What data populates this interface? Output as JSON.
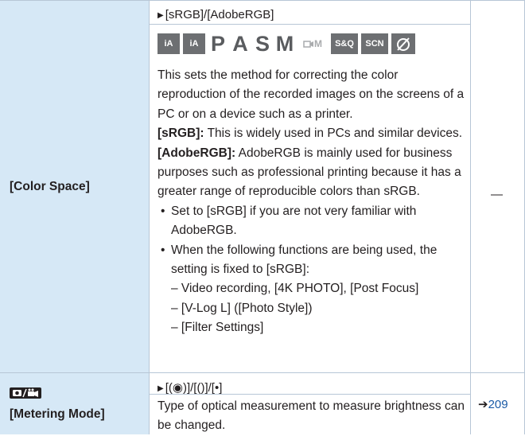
{
  "rows": [
    {
      "name": "[Color Space]",
      "options": "[sRGB]/[AdobeRGB]",
      "modes": {
        "icons": [
          "iA",
          "iA+",
          "P",
          "A",
          "S",
          "M",
          "movie-M",
          "S&Q",
          "SCN",
          "filter"
        ],
        "labels": [
          "iA",
          "iA",
          "P",
          "A",
          "S",
          "M",
          "M",
          "S&Q",
          "SCN"
        ]
      },
      "description": "This sets the method for correcting the color reproduction of the recorded images on the screens of a PC or on a device such as a printer.",
      "srgb_label": "[sRGB]:",
      "srgb_text": "This is widely used in PCs and similar devices.",
      "adobe_label": "[AdobeRGB]:",
      "adobe_text": "AdobeRGB is mainly used for business purposes such as professional printing because it has a greater range of reproducible colors than sRGB.",
      "bullets": [
        "Set to [sRGB] if you are not very familiar with AdobeRGB.",
        "When the following functions are being used, the setting is fixed to [sRGB]:"
      ],
      "subitems": [
        "– Video recording, [4K PHOTO], [Post Focus]",
        "– [V-Log L] ([Photo Style])",
        "– [Filter Settings]"
      ],
      "reference": "—"
    },
    {
      "name": "[Metering Mode]",
      "icon": "photo-video-icon",
      "options": "[(◉)]/[()]/[•]",
      "description": "Type of optical measurement to measure brightness can be changed.",
      "reference_arrow": "➔",
      "reference": "209"
    }
  ],
  "colors": {
    "label_bg": "#d6e8f6",
    "grid": "#b7c6d6",
    "link": "#1a5aa6",
    "icon_gray": "#6d6f72"
  }
}
